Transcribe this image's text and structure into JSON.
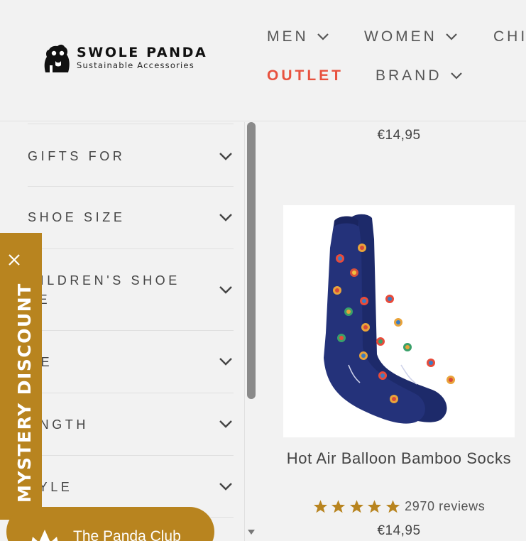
{
  "header": {
    "logo_title": "SWOLE PANDA",
    "logo_subtitle": "Sustainable Accessories",
    "nav": {
      "men": "MEN",
      "women": "WOMEN",
      "children": "CHI",
      "outlet": "OUTLET",
      "brand": "BRAND"
    },
    "outlet_color": "#e8523f"
  },
  "filters": [
    {
      "label": "GIFTS FOR"
    },
    {
      "label": "SHOE SIZE"
    },
    {
      "label": "HILDREN'S SHOE\nZE"
    },
    {
      "label": "GE"
    },
    {
      "label": "ENGTH"
    },
    {
      "label": "TYLE"
    }
  ],
  "products": {
    "previous_price": "€14,95",
    "item": {
      "title": "Hot Air Balloon Bamboo Socks",
      "rating_stars": 5,
      "reviews": "2970 reviews",
      "price": "€14,95"
    }
  },
  "mystery_discount": {
    "label": "MYSTERY DISCOUNT",
    "color": "#b8841f"
  },
  "panda_club": {
    "label": "The Panda Club"
  },
  "icons": {
    "chevron": "chevron-down-icon",
    "close": "close-icon",
    "star": "star-icon"
  }
}
